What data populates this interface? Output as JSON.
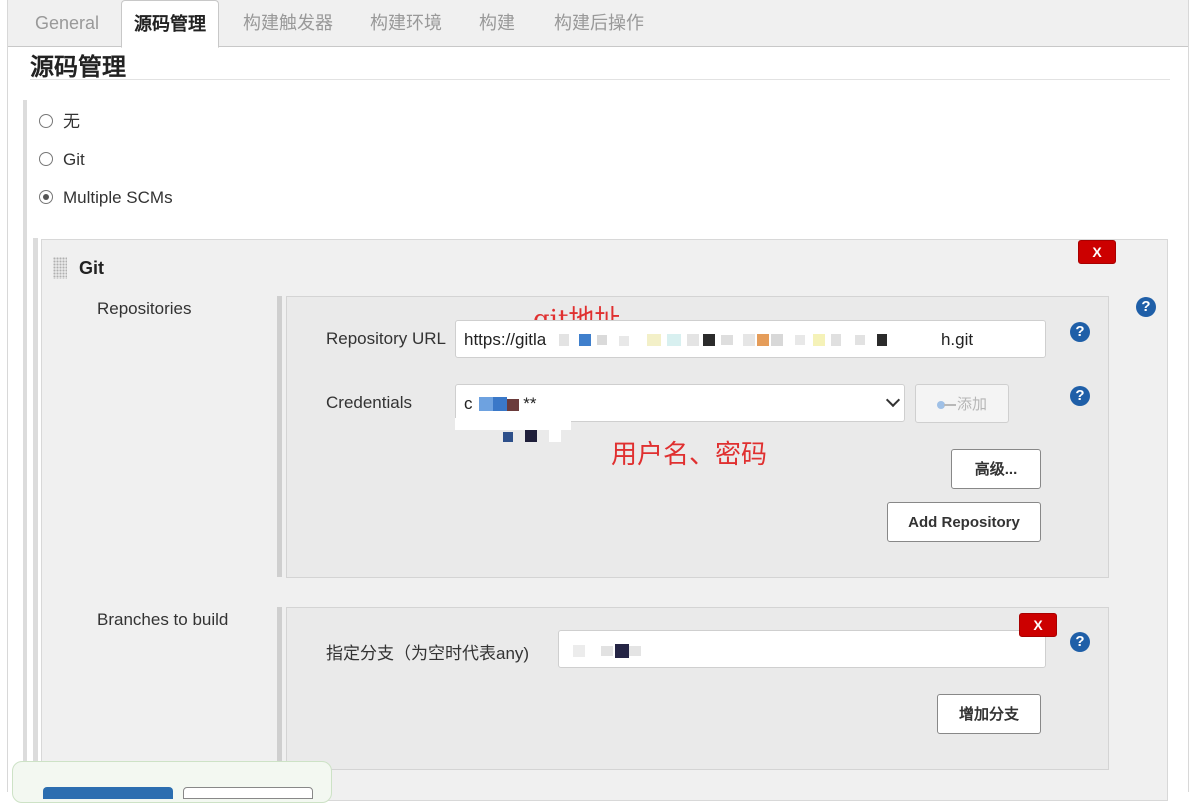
{
  "tabs": [
    {
      "label": "General",
      "active": false
    },
    {
      "label": "源码管理",
      "active": true
    },
    {
      "label": "构建触发器",
      "active": false
    },
    {
      "label": "构建环境",
      "active": false
    },
    {
      "label": "构建",
      "active": false
    },
    {
      "label": "构建后操作",
      "active": false
    }
  ],
  "section": {
    "title": "源码管理"
  },
  "scm_options": [
    {
      "label": "无",
      "selected": false
    },
    {
      "label": "Git",
      "selected": false
    },
    {
      "label": "Multiple SCMs",
      "selected": true
    }
  ],
  "git": {
    "title": "Git",
    "delete_label": "X",
    "repositories_label": "Repositories",
    "repository_url_label": "Repository URL",
    "repository_url_prefix": "https://gitla",
    "repository_url_suffix": "h.git",
    "credentials_label": "Credentials",
    "credentials_value_prefix": "c",
    "credentials_value_suffix": "**",
    "add_button_label": "添加",
    "advanced_button_label": "高级...",
    "add_repository_label": "Add Repository",
    "branches_label": "Branches to build",
    "branch_spec_label": "指定分支（为空时代表any)",
    "branch_delete_label": "X",
    "add_branch_label": "增加分支",
    "help_glyph": "?"
  },
  "annotations": {
    "git_address": "git地址",
    "user_password": "用户名、密码"
  },
  "colors": {
    "delete_red": "#cc0000",
    "help_blue": "#1f5fa8",
    "annotation_red": "#e03030",
    "primary_button_blue": "#2c6eb0"
  }
}
